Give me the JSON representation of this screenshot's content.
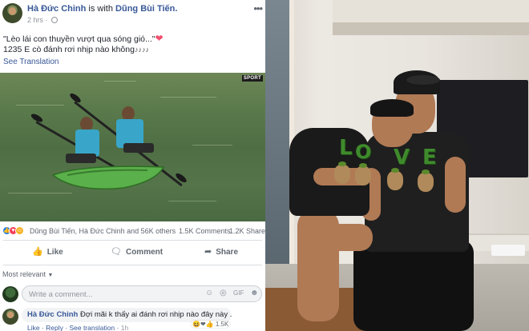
{
  "post": {
    "author": "Hà Đức Chinh",
    "with_text": "is with",
    "tagged": "Dũng Bùi Tiến.",
    "time": "2 hrs ·",
    "line1": "\"Lèo lái con thuyền vượt qua sóng gió...\"",
    "line2": "1235 E cò đánh rơi nhịp nào không",
    "notes": "♪♪♪♪",
    "see_translation": "See Translation",
    "photo_badge": "SPORT"
  },
  "reactions": {
    "reacted_by": "Dũng Bùi Tiến, Hà Đức Chinh and 56K others",
    "comments": "1.5K Comments",
    "shares": "1.2K Shares",
    "icons": [
      "like-icon",
      "love-icon",
      "haha-icon"
    ],
    "colors": {
      "like": "#1877f2",
      "love": "#f33e58",
      "haha": "#f7b125"
    }
  },
  "actions": {
    "like": "Like",
    "comment": "Comment",
    "share": "Share"
  },
  "comments": {
    "sort_label": "Most relevant",
    "placeholder": "Write a comment...",
    "reply_author": "Hà Đức Chinh",
    "reply_text": "Đợi mãi k thấy ai đánh rơi nhịp nào đây này ...",
    "reply_reaction_count": "1.5K",
    "reply_like": "Like",
    "reply_reply": "Reply",
    "reply_see_translation": "See translation",
    "reply_time": "1h"
  },
  "right_photo": {
    "love_letters": [
      "L",
      "O",
      "V",
      "E"
    ]
  },
  "colors": {
    "link": "#385898",
    "text": "#1d2129",
    "muted": "#606770"
  }
}
